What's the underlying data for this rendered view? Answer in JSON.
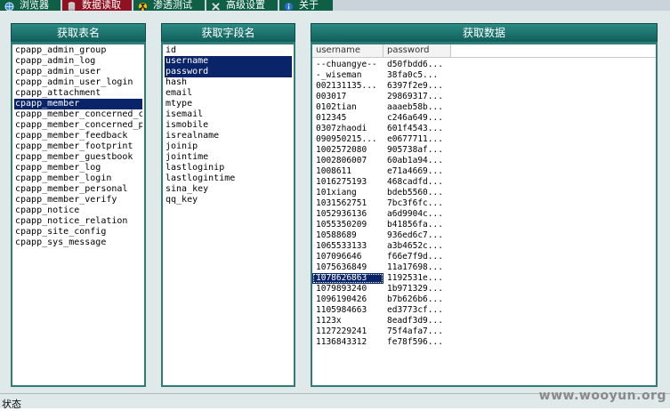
{
  "toolbar": {
    "tabs": [
      {
        "label": "浏览器",
        "icon": "globe-icon"
      },
      {
        "label": "数据读取",
        "icon": "database-icon"
      },
      {
        "label": "渗透测试",
        "icon": "radiation-icon"
      },
      {
        "label": "高级设置",
        "icon": "tools-icon"
      },
      {
        "label": "关于",
        "icon": "info-icon"
      }
    ]
  },
  "tables_panel": {
    "title": "获取表名",
    "items": [
      "cpapp_admin_group",
      "cpapp_admin_log",
      "cpapp_admin_user",
      "cpapp_admin_user_login",
      "cpapp_attachment",
      "cpapp_member",
      "cpapp_member_concerned_c",
      "cpapp_member_concerned_p",
      "cpapp_member_feedback",
      "cpapp_member_footprint",
      "cpapp_member_guestbook",
      "cpapp_member_log",
      "cpapp_member_login",
      "cpapp_member_personal",
      "cpapp_member_verify",
      "cpapp_notice",
      "cpapp_notice_relation",
      "cpapp_site_config",
      "cpapp_sys_message"
    ],
    "selected": "cpapp_member"
  },
  "fields_panel": {
    "title": "获取字段名",
    "items": [
      "id",
      "username",
      "password",
      "hash",
      "email",
      "mtype",
      "isemail",
      "ismobile",
      "isrealname",
      "joinip",
      "jointime",
      "lastloginip",
      "lastlogintime",
      "sina_key",
      "qq_key"
    ],
    "selected": [
      "username",
      "password"
    ]
  },
  "data_panel": {
    "title": "获取数据",
    "columns": [
      "username",
      "password"
    ],
    "rows": [
      [
        "--chuangye--",
        "d50fbdd6..."
      ],
      [
        "-_wiseman",
        "38fa0c5..."
      ],
      [
        "002131135...",
        "6397f2e9..."
      ],
      [
        "003017",
        "29869317..."
      ],
      [
        "0102tian",
        "aaaeb58b..."
      ],
      [
        "012345",
        "c246a649..."
      ],
      [
        "0307zhaodi",
        "601f4543..."
      ],
      [
        "090950215...",
        "e0677711..."
      ],
      [
        "1002572080",
        "905738af..."
      ],
      [
        "1002806007",
        "60ab1a94..."
      ],
      [
        "1008611",
        "e71a4669..."
      ],
      [
        "1016275193",
        "468cadfd..."
      ],
      [
        "101xiang",
        "bdeb5560..."
      ],
      [
        "1031562751",
        "7bc3f6fc..."
      ],
      [
        "1052936136",
        "a6d9904c..."
      ],
      [
        "1055350209",
        "b41856fa..."
      ],
      [
        "10588689",
        "936ed6c7..."
      ],
      [
        "1065533133",
        "a3b4652c..."
      ],
      [
        "107096646",
        "f66e7f9d..."
      ],
      [
        "1075636849",
        "11a17698..."
      ],
      [
        "1078626863",
        "1192531e..."
      ],
      [
        "1079893240",
        "1b971329..."
      ],
      [
        "1096190426",
        "b7b626b6..."
      ],
      [
        "1105984663",
        "ed3773cf..."
      ],
      [
        "1123x",
        "8eadf3d9..."
      ],
      [
        "1127229241",
        "75f4afa7..."
      ],
      [
        "1136843312",
        "fe78f596..."
      ]
    ],
    "highlighted_row": 20
  },
  "statusbar": {
    "label": "状态",
    "watermark": "www.wooyun.org"
  },
  "colors": {
    "toolbar_tab": "#0e5f46",
    "active_tab": "#8f1220",
    "header": "#1f716c",
    "selection": "#0a246a",
    "panel_bg": "#dfe9ea"
  }
}
